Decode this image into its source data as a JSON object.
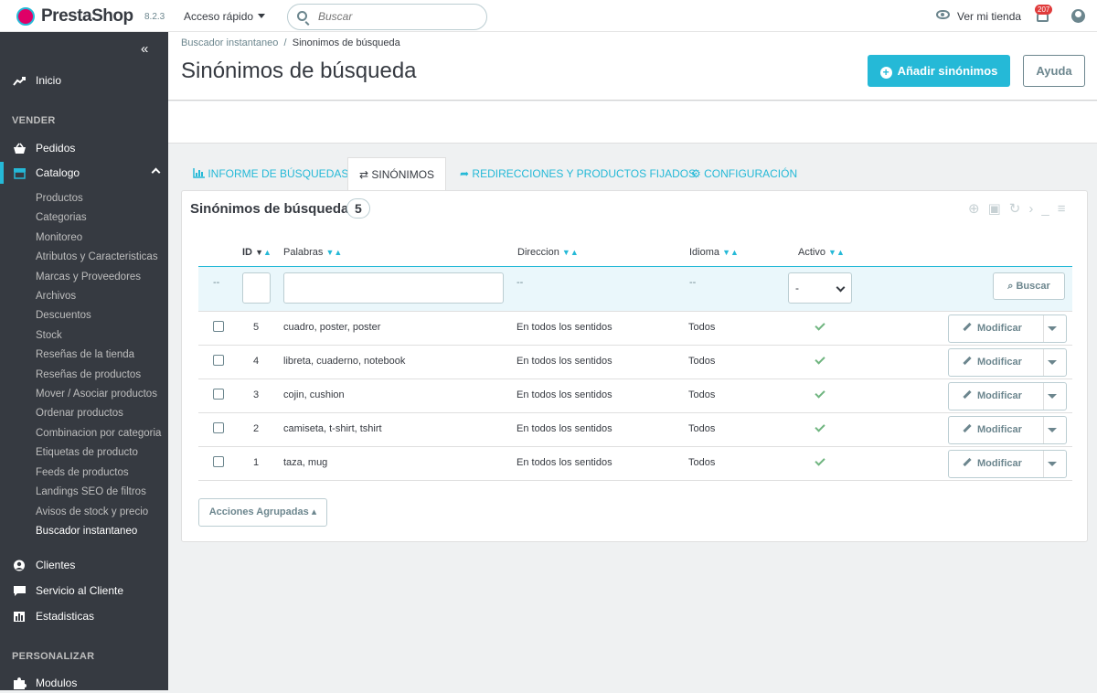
{
  "topbar": {
    "logo_prefix": "Presta",
    "logo_suffix": "Shop",
    "version": "8.2.3",
    "quick_access": "Acceso rápido",
    "search_placeholder": "Buscar",
    "view_store": "Ver mi tienda",
    "notifications": "207"
  },
  "sidebar": {
    "collapse": "«",
    "home": "Inicio",
    "section_sell": "VENDER",
    "orders": "Pedidos",
    "catalog": "Catalogo",
    "catalog_items": [
      "Productos",
      "Categorias",
      "Monitoreo",
      "Atributos y Caracteristicas",
      "Marcas y Proveedores",
      "Archivos",
      "Descuentos",
      "Stock",
      "Reseñas de la tienda",
      "Reseñas de productos",
      "Mover / Asociar productos",
      "Ordenar productos",
      "Combinacion por categoria",
      "Etiquetas de producto",
      "Feeds de productos",
      "Landings SEO de filtros",
      "Avisos de stock y precio",
      "Buscador instantaneo"
    ],
    "clients": "Clientes",
    "customer_service": "Servicio al Cliente",
    "stats": "Estadisticas",
    "section_customize": "PERSONALIZAR",
    "modules": "Modulos"
  },
  "header": {
    "breadcrumb_parent": "Buscador instantaneo",
    "breadcrumb_sep": "/",
    "breadcrumb_current": "Sinonimos de búsqueda",
    "title": "Sinónimos de búsqueda",
    "add_button": "Añadir sinónimos",
    "help_button": "Ayuda"
  },
  "tabs": [
    {
      "label": "INFORME DE BÚSQUEDAS",
      "icon": "bar-chart-icon"
    },
    {
      "label": "SINÓNIMOS",
      "icon": "exchange-icon"
    },
    {
      "label": "REDIRECCIONES Y PRODUCTOS FIJADOS",
      "icon": "share-icon"
    },
    {
      "label": "CONFIGURACIÓN",
      "icon": "cogs-icon"
    }
  ],
  "panel": {
    "title": "Sinónimos de búsqueda",
    "count": "5",
    "columns": {
      "id": "ID",
      "words": "Palabras",
      "direction": "Direccion",
      "language": "Idioma",
      "active": "Activo"
    },
    "filter": {
      "dash": "--",
      "select_value": "-",
      "search_button": "Buscar"
    },
    "rows": [
      {
        "id": "5",
        "words": "cuadro, poster, poster",
        "direction": "En todos los sentidos",
        "language": "Todos",
        "action": "Modificar"
      },
      {
        "id": "4",
        "words": "libreta, cuaderno, notebook",
        "direction": "En todos los sentidos",
        "language": "Todos",
        "action": "Modificar"
      },
      {
        "id": "3",
        "words": "cojin, cushion",
        "direction": "En todos los sentidos",
        "language": "Todos",
        "action": "Modificar"
      },
      {
        "id": "2",
        "words": "camiseta, t-shirt, tshirt",
        "direction": "En todos los sentidos",
        "language": "Todos",
        "action": "Modificar"
      },
      {
        "id": "1",
        "words": "taza, mug",
        "direction": "En todos los sentidos",
        "language": "Todos",
        "action": "Modificar"
      }
    ],
    "bulk_actions": "Acciones Agrupadas ▴"
  },
  "colors": {
    "accent": "#25b9d7",
    "sidebar": "#363a41",
    "brand": "#df0067",
    "success": "#70b580"
  }
}
